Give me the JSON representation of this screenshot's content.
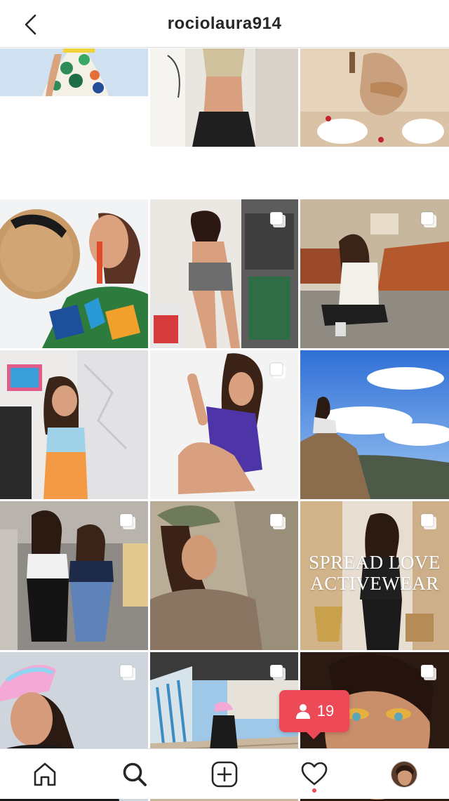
{
  "header": {
    "username": "rociolaura914"
  },
  "grid": {
    "posts": [
      {
        "index": 1,
        "multiple": false,
        "overlay": ""
      },
      {
        "index": 2,
        "multiple": false,
        "overlay": ""
      },
      {
        "index": 3,
        "multiple": false,
        "overlay": ""
      },
      {
        "index": 4,
        "multiple": false,
        "overlay": ""
      },
      {
        "index": 5,
        "multiple": true,
        "overlay": ""
      },
      {
        "index": 6,
        "multiple": true,
        "overlay": ""
      },
      {
        "index": 7,
        "multiple": false,
        "overlay": ""
      },
      {
        "index": 8,
        "multiple": true,
        "overlay": ""
      },
      {
        "index": 9,
        "multiple": false,
        "overlay": ""
      },
      {
        "index": 10,
        "multiple": true,
        "overlay": ""
      },
      {
        "index": 11,
        "multiple": true,
        "overlay": ""
      },
      {
        "index": 12,
        "multiple": true,
        "overlay_line1": "SPREAD LOVE",
        "overlay_line2": "ACTIVEWEAR"
      },
      {
        "index": 13,
        "multiple": true,
        "overlay": ""
      },
      {
        "index": 14,
        "multiple": true,
        "overlay": ""
      },
      {
        "index": 15,
        "multiple": true,
        "overlay": ""
      }
    ]
  },
  "notification_badge": {
    "count": "19",
    "icon": "person-icon",
    "color": "#ed4956"
  },
  "tabbar": {
    "items": [
      "home-icon",
      "search-icon",
      "add-post-icon",
      "heart-icon",
      "profile-avatar"
    ],
    "active": "search-icon"
  }
}
